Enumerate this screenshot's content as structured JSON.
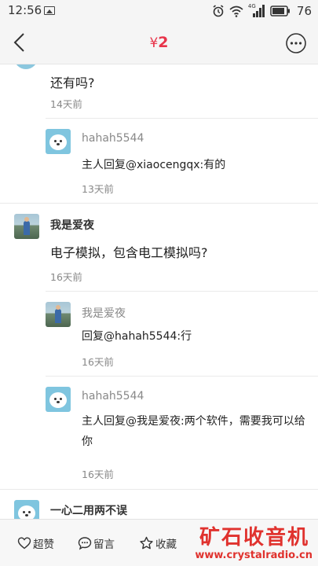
{
  "status_bar": {
    "time": "12:56",
    "network_label": "4G",
    "battery_percent": "76"
  },
  "header": {
    "currency": "¥",
    "amount": "2"
  },
  "comments": [
    {
      "message": "还有吗?",
      "time": "14天前",
      "replies": [
        {
          "name": "hahah5544",
          "text": "主人回复@xiaocengqx:有的",
          "time": "13天前"
        }
      ]
    },
    {
      "name": "我是爱夜",
      "message": "电子模拟，包含电工模拟吗?",
      "time": "16天前",
      "replies": [
        {
          "name": "我是爱夜",
          "text": "回复@hahah5544:行",
          "time": "16天前"
        },
        {
          "name": "hahah5544",
          "text": "主人回复@我是爱夜:两个软件，需要我可以给你",
          "time": "16天前"
        }
      ]
    },
    {
      "name": "一心二用两不误"
    }
  ],
  "bottom_bar": {
    "like_label": "超赞",
    "comment_label": "留言",
    "favorite_label": "收藏"
  },
  "watermark": {
    "cn": "矿石收音机",
    "en": "www.crystalradio.cn"
  },
  "colors": {
    "accent_red": "#e8344a",
    "watermark_red": "#e0322e"
  }
}
